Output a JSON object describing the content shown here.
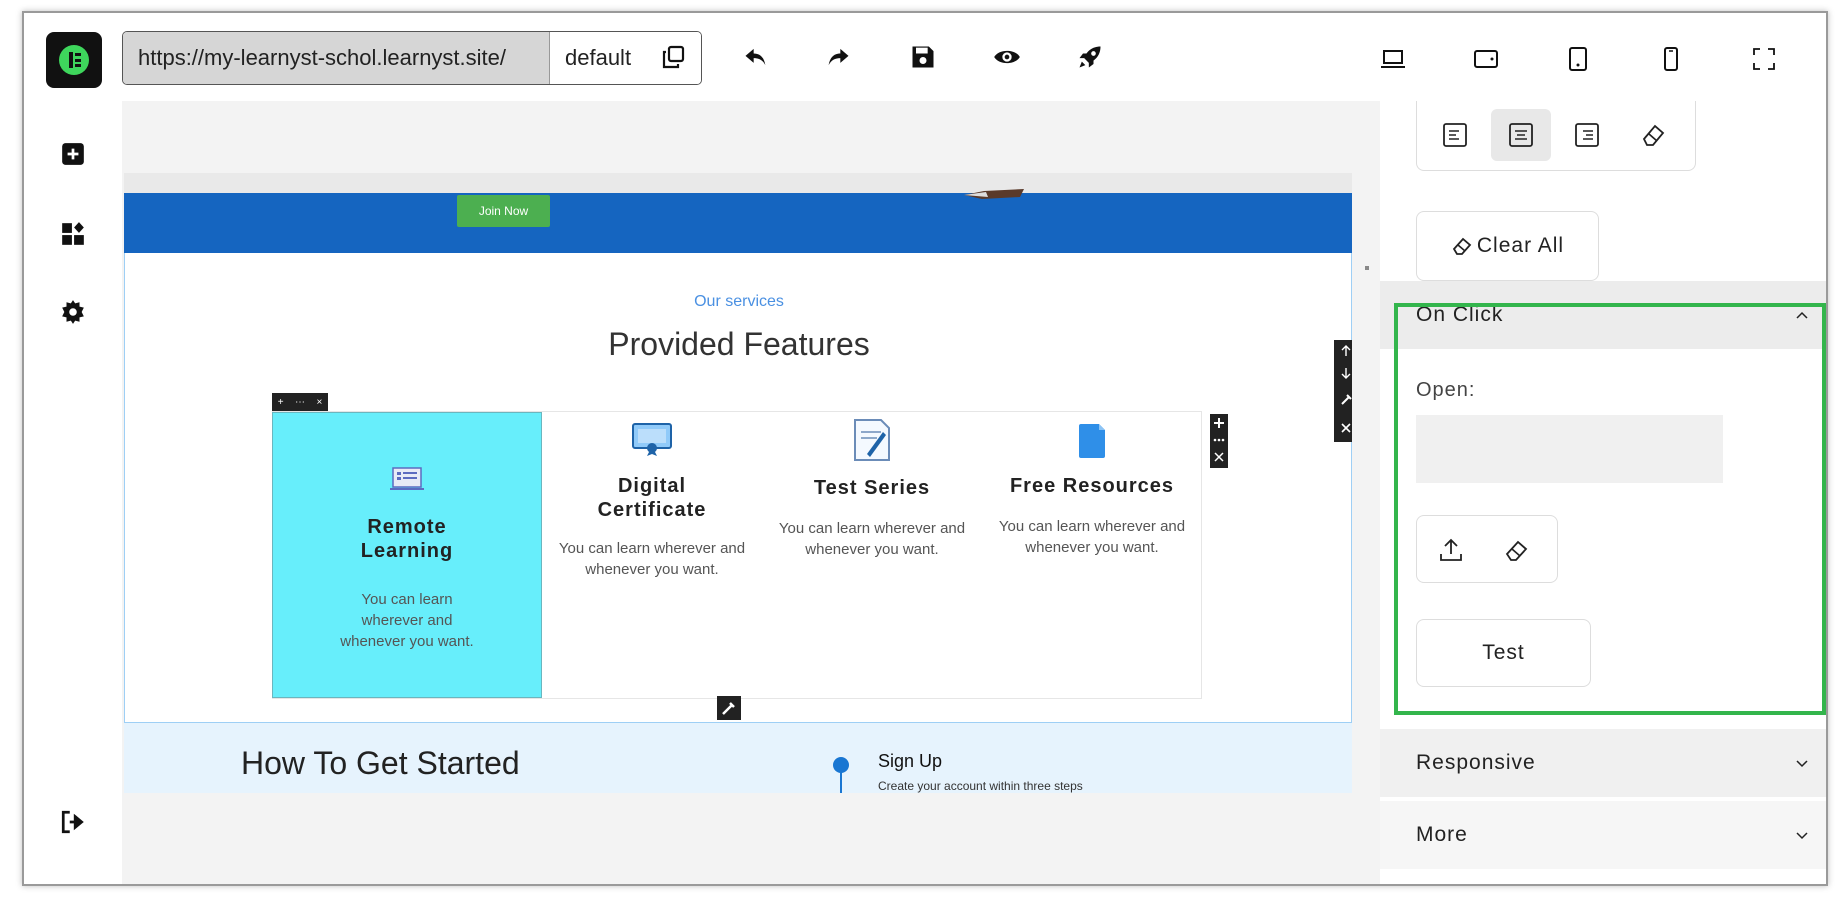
{
  "toolbar": {
    "url": "https://my-learnyst-schol.learnyst.site/",
    "default_label": "default",
    "icons": [
      "undo-icon",
      "redo-icon",
      "save-icon",
      "preview-eye-icon",
      "publish-rocket-icon"
    ],
    "devices": [
      "desktop-icon",
      "tablet-landscape-icon",
      "tablet-portrait-icon",
      "mobile-icon",
      "fullscreen-icon"
    ]
  },
  "sidebar": {
    "icons": [
      "add-block-icon",
      "layers-icon",
      "settings-icon",
      "logout-icon"
    ]
  },
  "canvas": {
    "hero": {
      "join_label": "Join Now"
    },
    "services": {
      "label": "Our services",
      "title": "Provided Features",
      "features": [
        {
          "title": "Remote Learning",
          "desc": "You can learn wherever and whenever you want."
        },
        {
          "title": "Digital Certificate",
          "desc": "You can learn wherever and whenever you want."
        },
        {
          "title": "Test Series",
          "desc": "You can learn wherever and whenever you want."
        },
        {
          "title": "Free Resources",
          "desc": "You can learn wherever and whenever you want."
        }
      ]
    },
    "how": {
      "title": "How To Get Started",
      "step_title": "Sign Up",
      "step_desc": "Create your account within three steps"
    }
  },
  "panel": {
    "clear_all_label": "Clear All",
    "onclick": {
      "title": "On Click",
      "open_label": "Open:",
      "open_value": "",
      "test_label": "Test"
    },
    "accordions": {
      "responsive": "Responsive",
      "more": "More"
    },
    "highlight_color": "#33b54c",
    "accent": "#1565c0"
  }
}
